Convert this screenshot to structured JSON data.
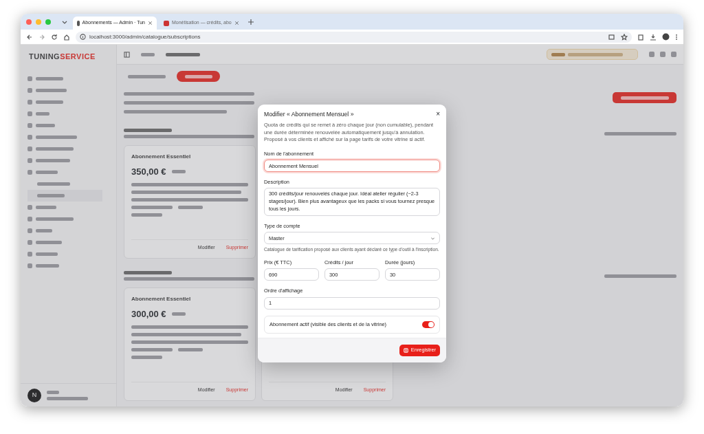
{
  "browser": {
    "tabs": [
      {
        "title": "Abonnements — Admin · Tun",
        "selected": true
      },
      {
        "title": "Monétisation — crédits, abo",
        "selected": false
      }
    ],
    "url": "localhost:3000/admin/catalogue/subscriptions"
  },
  "app": {
    "logo": {
      "first": "TUNING",
      "second": "SERVICE"
    },
    "avatar": "N",
    "cards": [
      {
        "title": "Abonnement Essentiel",
        "price": "350,00 €",
        "edit": "Modifier",
        "delete": "Supprimer"
      },
      {
        "title": "Abonnement Essentiel",
        "price": "300,00 €",
        "edit": "Modifier",
        "delete": "Supprimer"
      }
    ],
    "hidden_card_actions": {
      "edit": "Modifier",
      "delete": "Supprimer"
    }
  },
  "modal": {
    "title": "Modifier « Abonnement Mensuel »",
    "close": "×",
    "intro": "Quota de crédits qui se remet à zéro chaque jour (non cumulable), pendant une durée déterminée renouvelée automatiquement jusqu'à annulation. Proposé à vos clients et affiché sur la page tarifs de votre vitrine si actif.",
    "name": {
      "label": "Nom de l'abonnement",
      "value": "Abonnement Mensuel"
    },
    "description": {
      "label": "Description",
      "value": "300 crédits/jour renouvelés chaque jour. Idéal atelier régulier (~2-3 stages/jour). Bien plus avantageux que les packs si vous tournez presque tous les jours."
    },
    "account_type": {
      "label": "Type de compte",
      "value": "Master",
      "help": "Catalogue de tarification proposé aux clients ayant déclaré ce type d'outil à l'inscription."
    },
    "numbers": [
      {
        "label": "Prix (€ TTC)",
        "value": "690"
      },
      {
        "label": "Crédits / jour",
        "value": "300"
      },
      {
        "label": "Durée (jours)",
        "value": "30"
      }
    ],
    "order": {
      "label": "Ordre d'affichage",
      "value": "1"
    },
    "active_toggle": {
      "label": "Abonnement actif (visible des clients et de la vitrine)",
      "on": true
    },
    "save": "Enregistrer"
  }
}
